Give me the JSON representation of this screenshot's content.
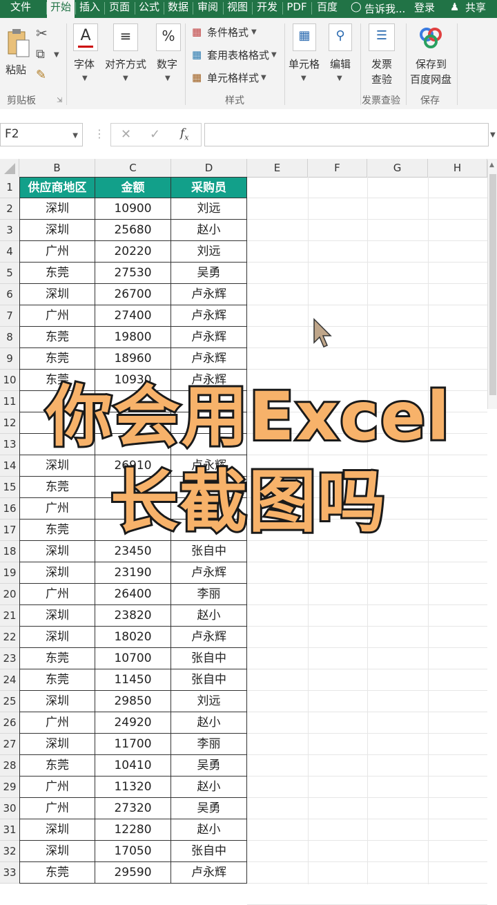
{
  "tabs": [
    {
      "label": "文件",
      "active": false
    },
    {
      "label": "开始",
      "active": true
    },
    {
      "label": "插入",
      "active": false
    },
    {
      "label": "页面",
      "active": false
    },
    {
      "label": "公式",
      "active": false
    },
    {
      "label": "数据",
      "active": false
    },
    {
      "label": "审阅",
      "active": false
    },
    {
      "label": "视图",
      "active": false
    },
    {
      "label": "开发",
      "active": false
    },
    {
      "label": "PDF",
      "active": false
    },
    {
      "label": "百度",
      "active": false
    }
  ],
  "tell_me": "告诉我...",
  "login": "登录",
  "share": "共享",
  "ribbon": {
    "paste": "粘贴",
    "font": "字体",
    "align": "对齐方式",
    "number": "数字",
    "conditional_format": "条件格式",
    "table_format": "套用表格格式",
    "cell_style": "单元格样式",
    "cells": "单元格",
    "edit": "编辑",
    "invoice_check_1": "发票",
    "invoice_check_2": "查验",
    "save_to_1": "保存到",
    "save_to_2": "百度网盘",
    "group_clipboard": "剪贴板",
    "group_style": "样式",
    "group_invoice": "发票查验",
    "group_save": "保存"
  },
  "formula_bar": {
    "name_box": "F2",
    "value": ""
  },
  "columns": [
    "B",
    "C",
    "D",
    "E",
    "F",
    "G",
    "H"
  ],
  "table": {
    "headers": [
      "供应商地区",
      "金额",
      "采购员"
    ],
    "rows": [
      {
        "n": "2",
        "b": "深圳",
        "c": "10900",
        "d": "刘远"
      },
      {
        "n": "3",
        "b": "深圳",
        "c": "25680",
        "d": "赵小"
      },
      {
        "n": "4",
        "b": "广州",
        "c": "20220",
        "d": "刘远"
      },
      {
        "n": "5",
        "b": "东莞",
        "c": "27530",
        "d": "吴勇"
      },
      {
        "n": "6",
        "b": "深圳",
        "c": "26700",
        "d": "卢永辉"
      },
      {
        "n": "7",
        "b": "广州",
        "c": "27400",
        "d": "卢永辉"
      },
      {
        "n": "8",
        "b": "东莞",
        "c": "19800",
        "d": "卢永辉"
      },
      {
        "n": "9",
        "b": "东莞",
        "c": "18960",
        "d": "卢永辉"
      },
      {
        "n": "10",
        "b": "东莞",
        "c": "10930",
        "d": "卢永辉"
      },
      {
        "n": "11",
        "b": "",
        "c": "",
        "d": ""
      },
      {
        "n": "12",
        "b": "",
        "c": "",
        "d": ""
      },
      {
        "n": "13",
        "b": "",
        "c": "",
        "d": ""
      },
      {
        "n": "14",
        "b": "深圳",
        "c": "26910",
        "d": "卢永辉"
      },
      {
        "n": "15",
        "b": "东莞",
        "c": "",
        "d": ""
      },
      {
        "n": "16",
        "b": "广州",
        "c": "",
        "d": ""
      },
      {
        "n": "17",
        "b": "东莞",
        "c": "",
        "d": ""
      },
      {
        "n": "18",
        "b": "深圳",
        "c": "23450",
        "d": "张自中"
      },
      {
        "n": "19",
        "b": "深圳",
        "c": "23190",
        "d": "卢永辉"
      },
      {
        "n": "20",
        "b": "广州",
        "c": "26400",
        "d": "李丽"
      },
      {
        "n": "21",
        "b": "深圳",
        "c": "23820",
        "d": "赵小"
      },
      {
        "n": "22",
        "b": "深圳",
        "c": "18020",
        "d": "卢永辉"
      },
      {
        "n": "23",
        "b": "东莞",
        "c": "10700",
        "d": "张自中"
      },
      {
        "n": "24",
        "b": "东莞",
        "c": "11450",
        "d": "张自中"
      },
      {
        "n": "25",
        "b": "深圳",
        "c": "29850",
        "d": "刘远"
      },
      {
        "n": "26",
        "b": "广州",
        "c": "24920",
        "d": "赵小"
      },
      {
        "n": "27",
        "b": "深圳",
        "c": "11700",
        "d": "李丽"
      },
      {
        "n": "28",
        "b": "东莞",
        "c": "10410",
        "d": "吴勇"
      },
      {
        "n": "29",
        "b": "广州",
        "c": "11320",
        "d": "赵小"
      },
      {
        "n": "30",
        "b": "广州",
        "c": "27320",
        "d": "吴勇"
      },
      {
        "n": "31",
        "b": "深圳",
        "c": "12280",
        "d": "赵小"
      },
      {
        "n": "32",
        "b": "深圳",
        "c": "17050",
        "d": "张自中"
      },
      {
        "n": "33",
        "b": "东莞",
        "c": "29590",
        "d": "卢永辉"
      }
    ]
  },
  "overlay": {
    "line1": "你会用Excel",
    "line2": "长截图吗"
  },
  "colors": {
    "excel_green": "#217346",
    "header_teal": "#12a08a",
    "caption_orange": "#f7b26a"
  }
}
